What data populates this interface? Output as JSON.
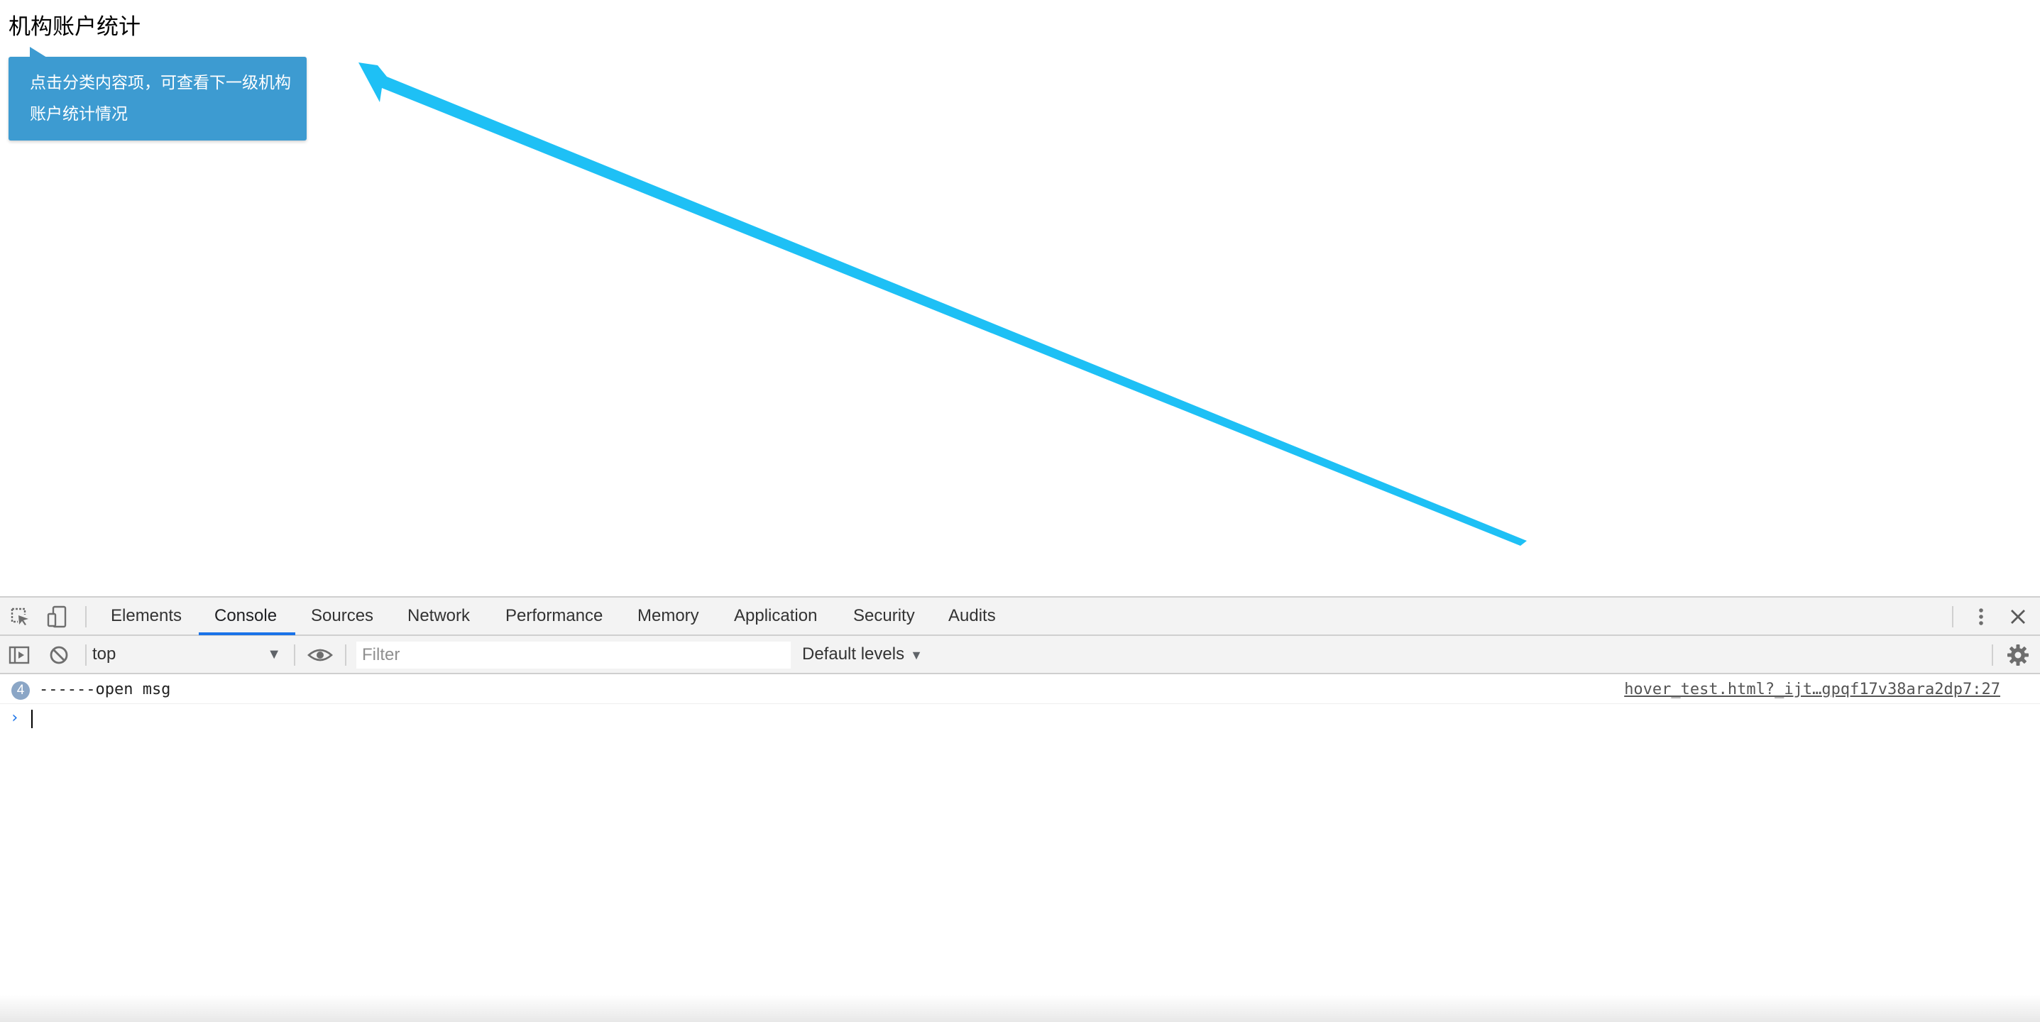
{
  "page": {
    "title": "机构账户统计",
    "tooltip": {
      "text": "点击分类内容项，可查看下一级机构账户统计情况"
    },
    "annotation": {
      "color": "#1ec0f5"
    }
  },
  "devtools": {
    "tabs": [
      {
        "label": "Elements",
        "active": false
      },
      {
        "label": "Console",
        "active": true
      },
      {
        "label": "Sources",
        "active": false
      },
      {
        "label": "Network",
        "active": false
      },
      {
        "label": "Performance",
        "active": false
      },
      {
        "label": "Memory",
        "active": false
      },
      {
        "label": "Application",
        "active": false
      },
      {
        "label": "Security",
        "active": false
      },
      {
        "label": "Audits",
        "active": false
      }
    ],
    "tab_icons": {
      "inspect": "inspect-element-icon",
      "device": "device-toolbar-icon",
      "menu": "more-vert-icon",
      "close": "close-icon"
    },
    "toolbar": {
      "context": "top",
      "filter_placeholder": "Filter",
      "filter_value": "",
      "levels": "Default levels"
    },
    "accent_color": "#1a73e8",
    "messages": [
      {
        "repeat_count": "4",
        "text": "------open msg",
        "source": "hover_test.html?_ijt…gpqf17v38ara2dp7:27"
      }
    ],
    "prompt": {
      "symbol": "›",
      "value": ""
    }
  }
}
